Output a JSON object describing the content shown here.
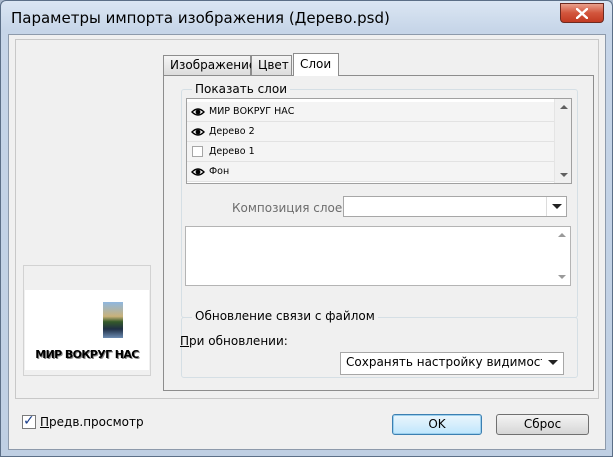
{
  "window": {
    "title": "Параметры импорта изображения (Дерево.psd)"
  },
  "tabs": [
    {
      "label": "Изображение"
    },
    {
      "label": "Цвет"
    },
    {
      "label": "Слои"
    }
  ],
  "preview": {
    "thumbnail_text": "МИР ВОКРУГ НАС",
    "checkbox_label_underline": "П",
    "checkbox_label_rest": "редв.просмотр",
    "checked": true
  },
  "layers": {
    "group_label": "Показать слои",
    "items": [
      {
        "name": "МИР ВОКРУГ НАС",
        "visible": true
      },
      {
        "name": "Дерево 2",
        "visible": true
      },
      {
        "name": "Дерево 1",
        "visible": false
      },
      {
        "name": "Фон",
        "visible": true
      }
    ],
    "composition_label": "Композиция слоев:",
    "composition_value": ""
  },
  "update": {
    "group_label": "Обновление связи с файлом",
    "when_label_underline": "П",
    "when_label_rest": "ри обновлении:",
    "when_value": "Сохранять настройку видимости слоев"
  },
  "buttons": {
    "ok": "OK",
    "reset": "Сброс"
  },
  "colors": {
    "titlebar": "#c6d5e8",
    "close": "#c23a22",
    "default_button": "#bee6fd"
  }
}
